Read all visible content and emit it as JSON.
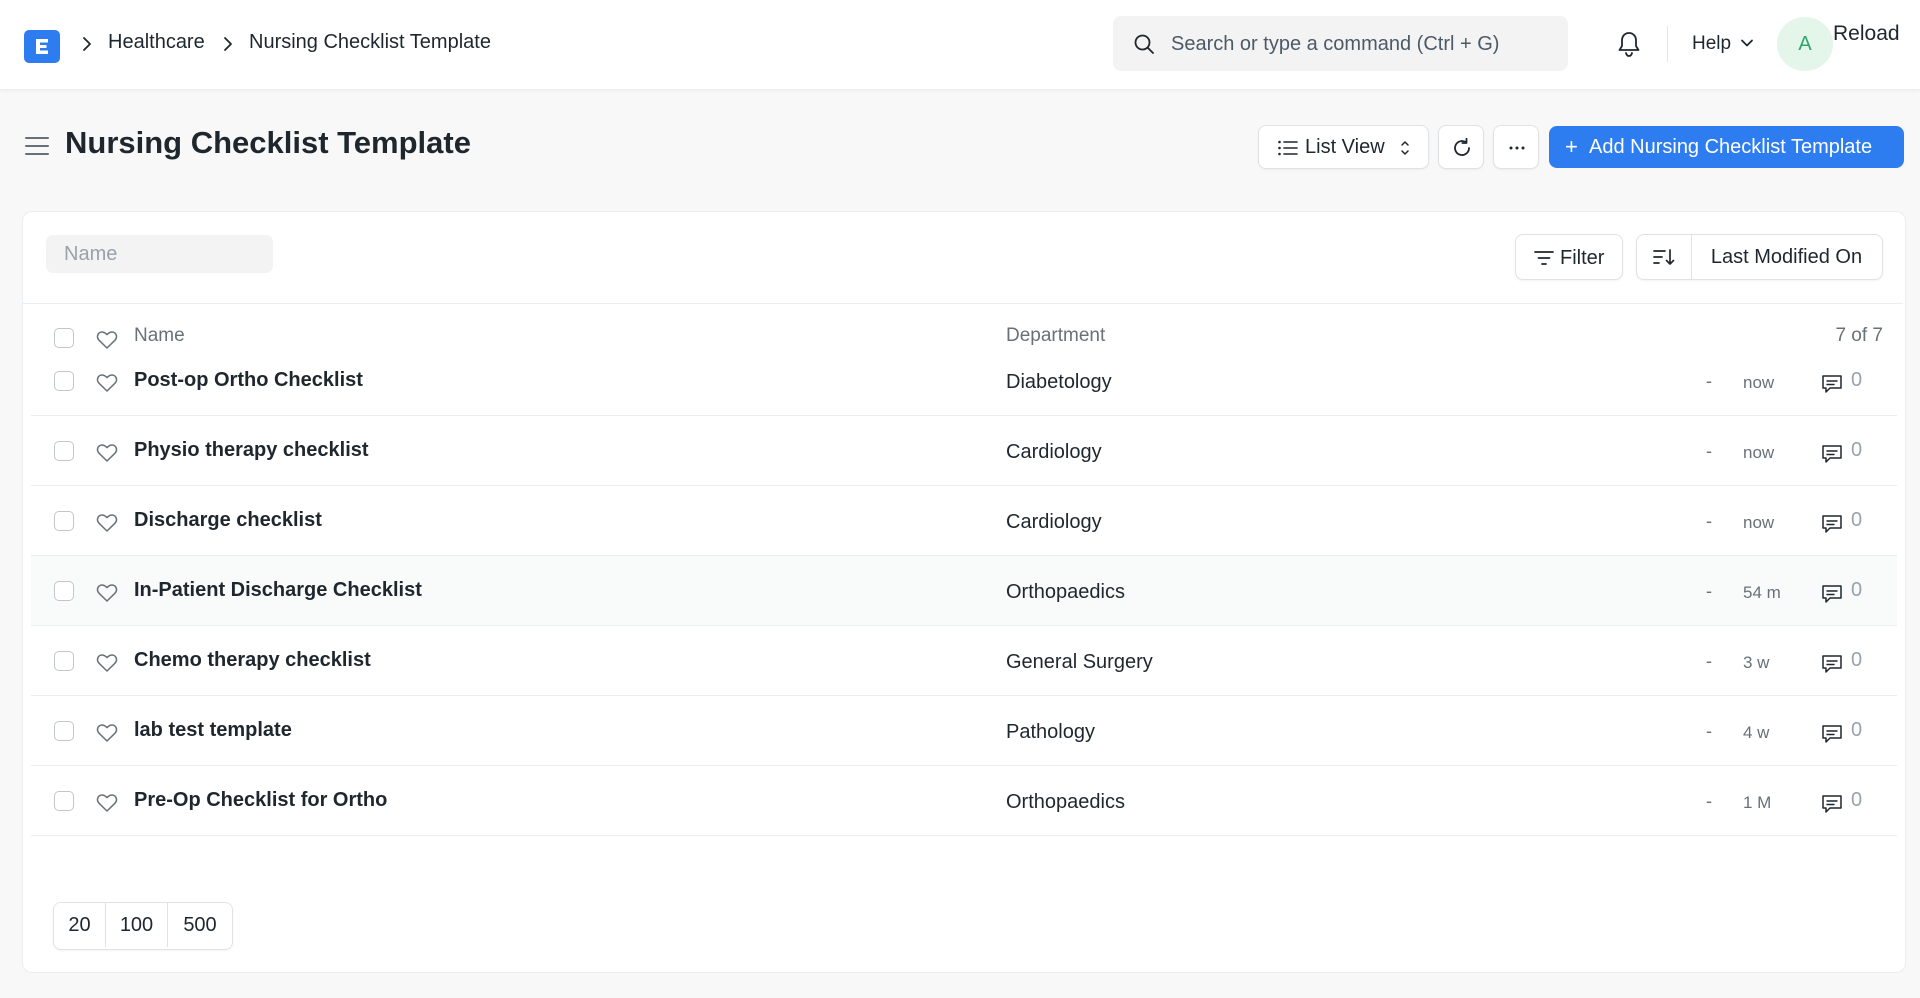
{
  "navbar": {
    "breadcrumbs": [
      "Healthcare",
      "Nursing Checklist Template"
    ],
    "search_placeholder": "Search or type a command (Ctrl + G)",
    "help_label": "Help",
    "avatar_initial": "A",
    "reload_label": "Reload"
  },
  "page": {
    "title": "Nursing Checklist Template",
    "view_label": "List View",
    "add_label": "Add Nursing Checklist Template",
    "add_plus": "+"
  },
  "filters": {
    "name_placeholder": "Name",
    "filter_label": "Filter",
    "sort_label": "Last Modified On"
  },
  "list": {
    "header": {
      "name": "Name",
      "department": "Department",
      "count": "7 of 7"
    },
    "rows": [
      {
        "name": "Post-op Ortho Checklist",
        "department": "Diabetology",
        "status": "-",
        "modified": "now",
        "comments": "0"
      },
      {
        "name": "Physio therapy checklist",
        "department": "Cardiology",
        "status": "-",
        "modified": "now",
        "comments": "0"
      },
      {
        "name": "Discharge checklist",
        "department": "Cardiology",
        "status": "-",
        "modified": "now",
        "comments": "0"
      },
      {
        "name": "In-Patient Discharge Checklist",
        "department": "Orthopaedics",
        "status": "-",
        "modified": "54 m",
        "comments": "0"
      },
      {
        "name": "Chemo therapy checklist",
        "department": "General Surgery",
        "status": "-",
        "modified": "3 w",
        "comments": "0"
      },
      {
        "name": "lab test template",
        "department": "Pathology",
        "status": "-",
        "modified": "4 w",
        "comments": "0"
      },
      {
        "name": "Pre-Op Checklist for Ortho",
        "department": "Orthopaedics",
        "status": "-",
        "modified": "1 M",
        "comments": "0"
      }
    ],
    "page_sizes": [
      "20",
      "100",
      "500"
    ]
  },
  "icons": {
    "logo": "erpnext-logo-icon",
    "search": "search-icon",
    "bell": "bell-icon",
    "menu": "hamburger-icon",
    "refresh": "refresh-icon",
    "more": "ellipsis-icon",
    "filter": "filter-icon",
    "sort": "sort-descending-icon",
    "heart": "heart-icon",
    "comment": "comment-icon"
  },
  "colors": {
    "primary": "#2e7df0",
    "avatar_bg": "#e4f5e9",
    "avatar_fg": "#30a66d"
  }
}
